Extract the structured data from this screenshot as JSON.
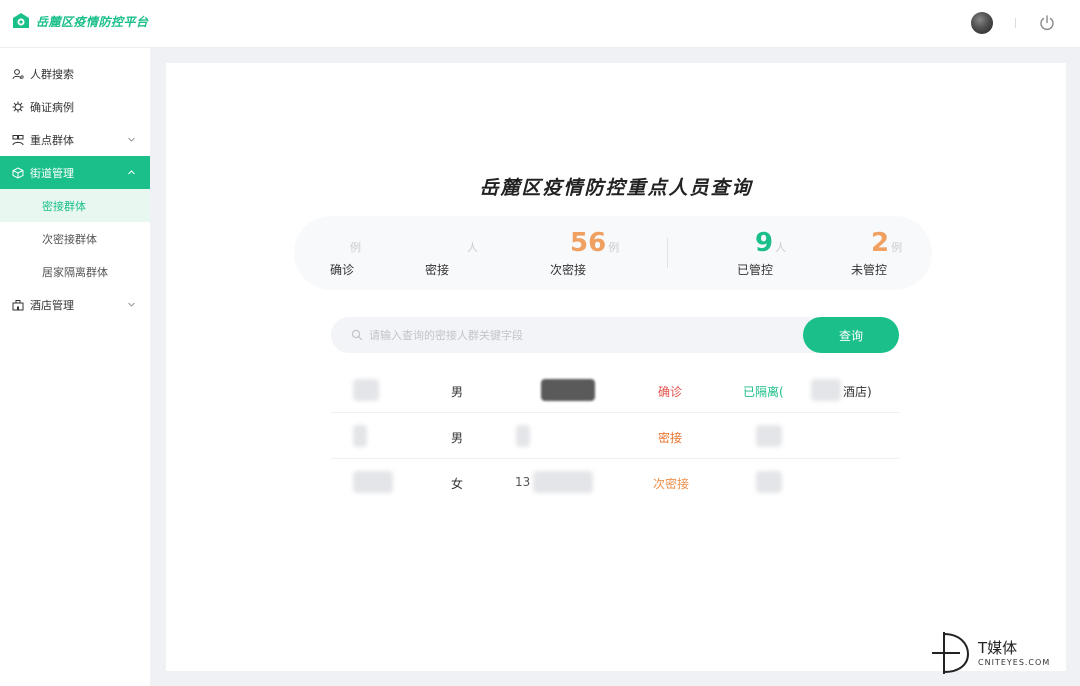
{
  "app": {
    "title": "岳麓区疫情防控平台"
  },
  "colors": {
    "accent": "#1bbf8a",
    "confirmed": "#e0524c",
    "contact": "#e8742e",
    "secondary_contact": "#ee8f4a"
  },
  "sidebar": {
    "items": [
      {
        "label": "人群搜索",
        "icon": "user-search-icon"
      },
      {
        "label": "确证病例",
        "icon": "virus-icon"
      },
      {
        "label": "重点群体",
        "icon": "group-icon"
      },
      {
        "label": "街道管理",
        "icon": "cube-icon"
      },
      {
        "label": "酒店管理",
        "icon": "hotel-icon"
      }
    ],
    "sub_items": [
      {
        "label": "密接群体"
      },
      {
        "label": "次密接群体"
      },
      {
        "label": "居家隔离群体"
      }
    ]
  },
  "main": {
    "title": "岳麓区疫情防控重点人员查询",
    "stats": [
      {
        "label": "确诊",
        "value": "",
        "unit": "例"
      },
      {
        "label": "密接",
        "value": "",
        "unit": "人"
      },
      {
        "label": "次密接",
        "value": "56",
        "unit": "例"
      },
      {
        "label": "已管控",
        "value": "9",
        "unit": "人"
      },
      {
        "label": "未管控",
        "value": "2",
        "unit": "例"
      }
    ],
    "search": {
      "placeholder": "请输入查询的密接人群关键字段",
      "value": "",
      "button": "查询"
    },
    "results": [
      {
        "gender": "男",
        "status": "确诊",
        "location": "已隔离(",
        "location_tail": "酒店)"
      },
      {
        "gender": "男",
        "status": "密接"
      },
      {
        "gender": "女",
        "phone_prefix": "13",
        "status": "次密接"
      }
    ]
  },
  "watermark": {
    "name": "T媒体",
    "site": "CNITEYES.COM"
  }
}
